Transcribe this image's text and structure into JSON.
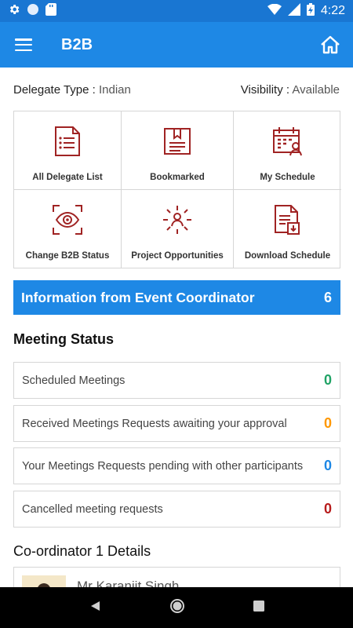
{
  "status_bar": {
    "time": "4:22"
  },
  "app_bar": {
    "title": "B2B"
  },
  "delegate": {
    "type_label": "Delegate Type :",
    "type_value": "Indian",
    "visibility_label": "Visibility :",
    "visibility_value": "Available"
  },
  "tiles": [
    {
      "label": "All Delegate List",
      "icon": "list-document-icon"
    },
    {
      "label": "Bookmarked",
      "icon": "book-icon"
    },
    {
      "label": "My Schedule",
      "icon": "calendar-user-icon"
    },
    {
      "label": "Change B2B Status",
      "icon": "eye-scan-icon"
    },
    {
      "label": "Project Opportunities",
      "icon": "people-network-icon"
    },
    {
      "label": "Download Schedule",
      "icon": "download-document-icon"
    }
  ],
  "info_bar": {
    "title": "Information from Event Coordinator",
    "count": "6"
  },
  "meeting_status": {
    "title": "Meeting Status",
    "items": [
      {
        "label": "Scheduled Meetings",
        "count": "0",
        "color": "#21a366"
      },
      {
        "label": "Received Meetings Requests awaiting your approval",
        "count": "0",
        "color": "#ff9800"
      },
      {
        "label": "Your Meetings Requests pending with other participants",
        "count": "0",
        "color": "#1e88e5"
      },
      {
        "label": "Cancelled meeting requests",
        "count": "0",
        "color": "#b71c1c"
      }
    ]
  },
  "coordinator": {
    "title": "Co-ordinator 1 Details",
    "name": "Mr Karanjit Singh"
  },
  "colors": {
    "primary": "#1e88e5",
    "icon_red": "#a02323"
  }
}
